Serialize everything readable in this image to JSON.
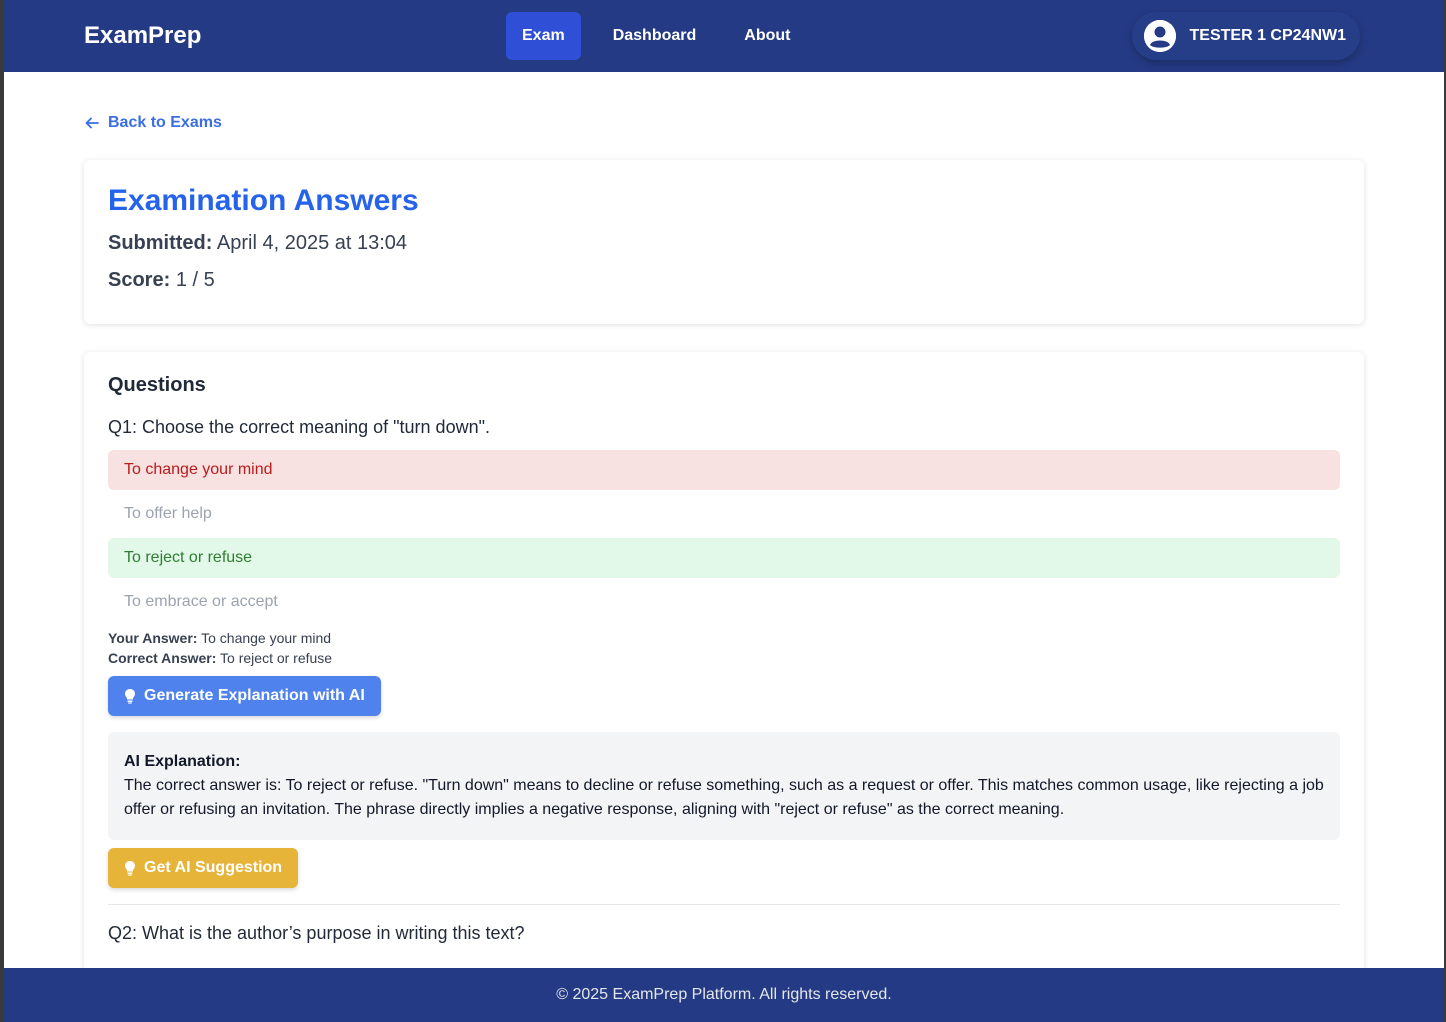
{
  "header": {
    "brand": "ExamPrep",
    "nav": [
      {
        "label": "Exam",
        "active": true
      },
      {
        "label": "Dashboard",
        "active": false
      },
      {
        "label": "About",
        "active": false
      }
    ],
    "user_name": "TESTER 1 CP24NW1"
  },
  "back_link": {
    "label": "Back to Exams"
  },
  "summary": {
    "title": "Examination Answers",
    "submitted_label": "Submitted:",
    "submitted_value": "April 4, 2025 at 13:04",
    "score_label": "Score:",
    "score_value": "1 / 5"
  },
  "questions": {
    "section_title": "Questions",
    "q1": {
      "text": "Q1: Choose the correct meaning of \"turn down\".",
      "options": [
        {
          "label": "To change your mind",
          "state": "wrong"
        },
        {
          "label": "To offer help",
          "state": "neutral"
        },
        {
          "label": "To reject or refuse",
          "state": "correct"
        },
        {
          "label": "To embrace or accept",
          "state": "neutral"
        }
      ],
      "your_answer_label": "Your Answer:",
      "your_answer": "To change your mind",
      "correct_answer_label": "Correct Answer:",
      "correct_answer": "To reject or refuse",
      "generate_button": "Generate Explanation with AI",
      "explanation_label": "AI Explanation:",
      "explanation_text": "The correct answer is: To reject or refuse. \"Turn down\" means to decline or refuse something, such as a request or offer. This matches common usage, like rejecting a job offer or refusing an invitation. The phrase directly implies a negative response, aligning with \"reject or refuse\" as the correct meaning.",
      "suggestion_button": "Get AI Suggestion"
    },
    "q2": {
      "text": "Q2: What is the author’s purpose in writing this text?"
    }
  },
  "footer": {
    "text": "© 2025 ExamPrep Platform. All rights reserved."
  },
  "colors": {
    "navbar": "#243a84",
    "accent": "#2563eb",
    "wrong_bg": "#f8e1e1",
    "correct_bg": "#e2f8e8",
    "suggest_btn": "#e7b43a"
  }
}
